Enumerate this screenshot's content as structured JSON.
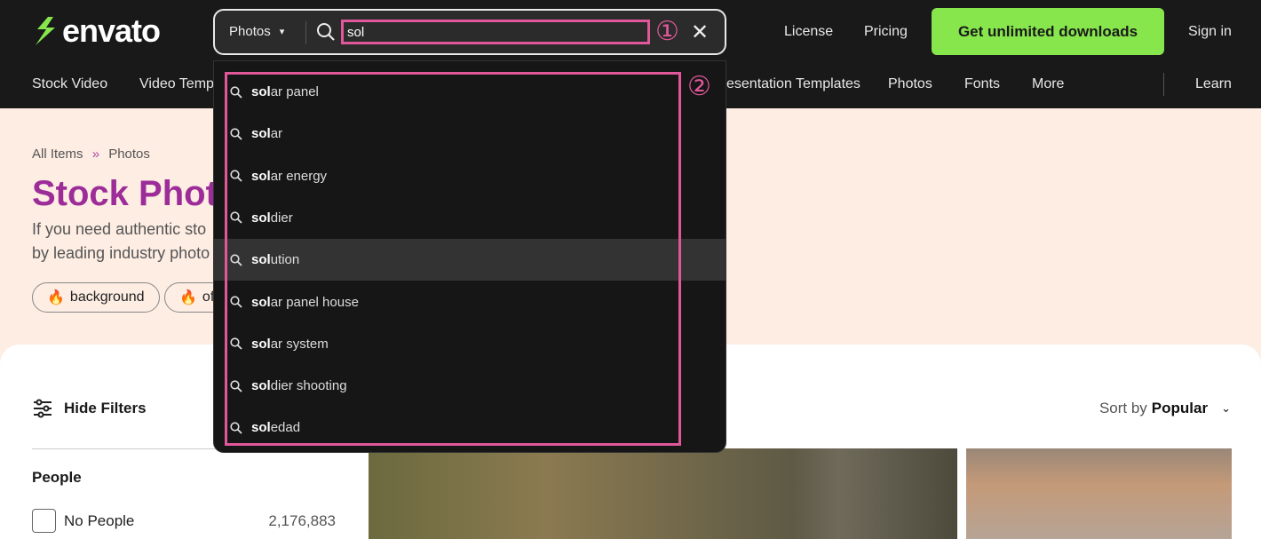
{
  "header": {
    "logo": "envato",
    "links": [
      "License",
      "Pricing"
    ],
    "cta": "Get unlimited downloads",
    "sign_in": "Sign in"
  },
  "nav": {
    "items": [
      "Stock Video",
      "Video Temp",
      "esentation Templates",
      "Photos",
      "Fonts",
      "More"
    ],
    "learn": "Learn"
  },
  "search": {
    "category": "Photos",
    "query": "sol",
    "annotation_1": "①",
    "annotation_2": "②"
  },
  "suggestions": [
    {
      "match": "sol",
      "rest": "ar panel"
    },
    {
      "match": "sol",
      "rest": "ar"
    },
    {
      "match": "sol",
      "rest": "ar energy"
    },
    {
      "match": "sol",
      "rest": "dier"
    },
    {
      "match": "sol",
      "rest": "ution",
      "highlighted": true
    },
    {
      "match": "sol",
      "rest": "ar panel house"
    },
    {
      "match": "sol",
      "rest": "ar system"
    },
    {
      "match": "sol",
      "rest": "dier shooting"
    },
    {
      "match": "sol",
      "rest": "edad"
    }
  ],
  "hero": {
    "breadcrumb": [
      "All Items",
      "»",
      "Photos"
    ],
    "title": "Stock Phot",
    "desc1": "If you need authentic sto",
    "desc2": "by leading industry photo",
    "chips": [
      "background",
      "of"
    ]
  },
  "filters": {
    "toggle": "Hide Filters",
    "section": "People",
    "options": [
      {
        "label": "No People",
        "count": "2,176,883",
        "checked": false
      }
    ]
  },
  "sort": {
    "label": "Sort by",
    "value": "Popular"
  },
  "colors": {
    "accent": "#87e64b",
    "title": "#9c2d98",
    "annotation": "#e0579a",
    "hero_bg": "#fdede3"
  }
}
